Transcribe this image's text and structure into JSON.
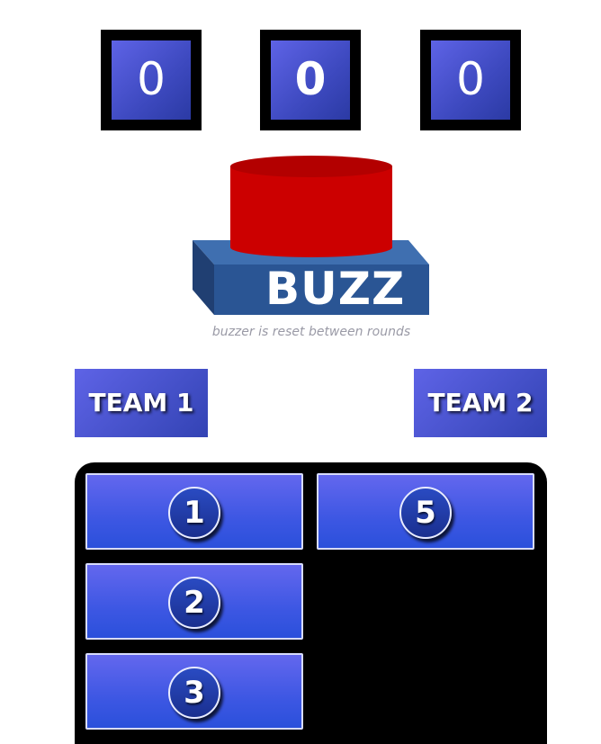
{
  "scores": {
    "team1": "0",
    "round": "0",
    "team2": "0"
  },
  "buzzer": {
    "label": "BUZZ",
    "hint": "buzzer is reset between rounds",
    "button_color": "#cc0000",
    "base_color": "#2a5594"
  },
  "teams": {
    "team1_label": "TEAM 1",
    "team2_label": "TEAM 2"
  },
  "board": {
    "answers": [
      "1",
      "2",
      "3",
      "5"
    ]
  }
}
